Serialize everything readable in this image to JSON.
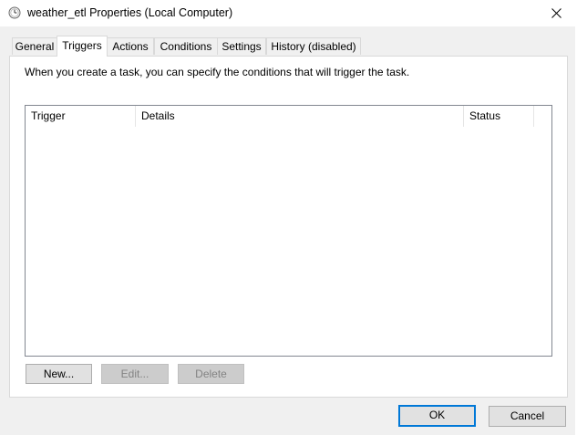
{
  "window": {
    "title": "weather_etl Properties (Local Computer)",
    "icon": "clock-icon"
  },
  "tabs": [
    {
      "label": "General",
      "active": false
    },
    {
      "label": "Triggers",
      "active": true
    },
    {
      "label": "Actions",
      "active": false
    },
    {
      "label": "Conditions",
      "active": false
    },
    {
      "label": "Settings",
      "active": false
    },
    {
      "label": "History (disabled)",
      "active": false
    }
  ],
  "triggers_panel": {
    "description": "When you create a task, you can specify the conditions that will trigger the task.",
    "columns": [
      "Trigger",
      "Details",
      "Status"
    ],
    "rows": [],
    "new_label": "New...",
    "edit_label": "Edit...",
    "delete_label": "Delete"
  },
  "footer": {
    "ok_label": "OK",
    "cancel_label": "Cancel"
  },
  "colors": {
    "accent": "#0078d7",
    "window_bg": "#f0f0f0",
    "panel_bg": "#ffffff"
  }
}
